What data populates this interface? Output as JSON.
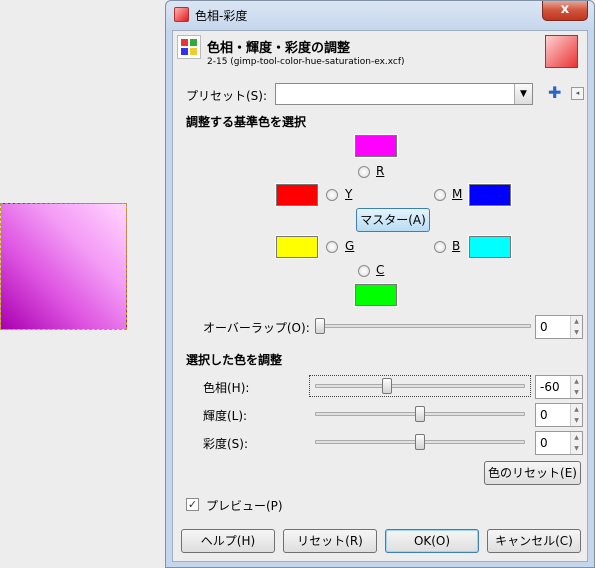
{
  "window": {
    "title": "色相-彩度",
    "close_glyph": "x"
  },
  "header": {
    "title": "色相・輝度・彩度の調整",
    "subtitle": "2-15 (gimp-tool-color-hue-saturation-ex.xcf)"
  },
  "preset": {
    "label": "プリセット(S):",
    "value": ""
  },
  "select_section": {
    "title": "調整する基準色を選択",
    "colors": [
      {
        "key": "R",
        "label": "R",
        "swatch": "#ff00ff"
      },
      {
        "key": "Y",
        "label": "Y",
        "swatch": "#ff0000"
      },
      {
        "key": "M",
        "label": "M",
        "swatch": "#0000ff"
      },
      {
        "key": "G",
        "label": "G",
        "swatch": "#ffff00"
      },
      {
        "key": "B",
        "label": "B",
        "swatch": "#00ffff"
      },
      {
        "key": "C",
        "label": "C",
        "swatch": "#00ff00"
      }
    ],
    "master_label": "マスター(A)"
  },
  "overlap": {
    "label": "オーバーラップ(O):",
    "value": "0",
    "level": 0.0
  },
  "adjust_section": {
    "title": "選択した色を調整",
    "hue": {
      "label": "色相(H):",
      "value": "-60",
      "level": 0.333
    },
    "lightness": {
      "label": "輝度(L):",
      "value": "0",
      "level": 0.5
    },
    "saturation": {
      "label": "彩度(S):",
      "value": "0",
      "level": 0.5
    },
    "reset_color_label": "色のリセット(E)"
  },
  "preview": {
    "label": "プレビュー(P)",
    "checked": true
  },
  "buttons": {
    "help": "ヘルプ(H)",
    "reset": "リセット(R)",
    "ok": "OK(O)",
    "cancel": "キャンセル(C)"
  }
}
